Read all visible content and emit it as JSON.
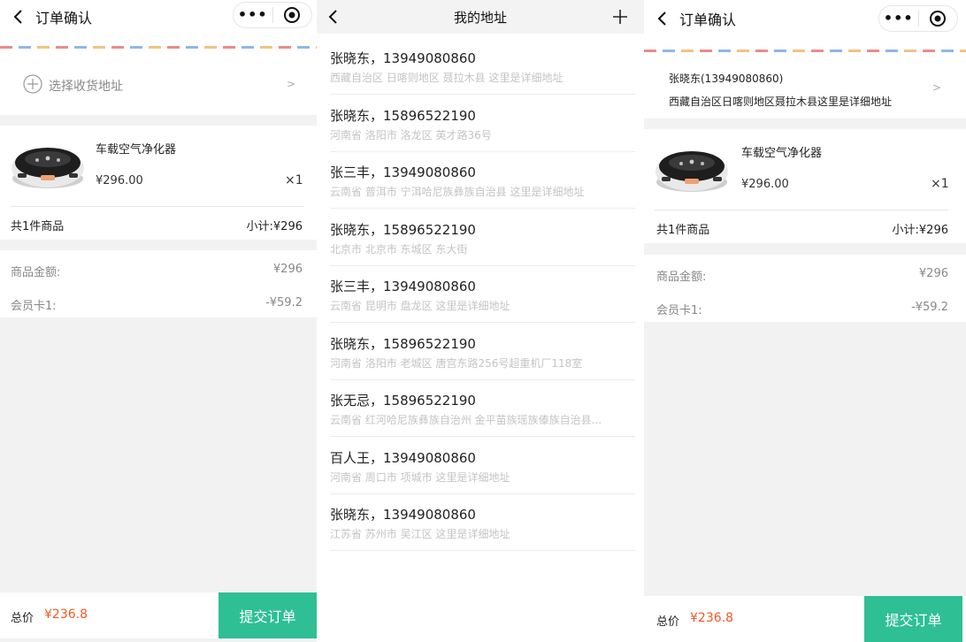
{
  "screen_order_1": {
    "title": "订单确认",
    "capsule_more": "•••",
    "select_address": "选择收货地址",
    "arrow": ">",
    "product_name": "车载空气净化器",
    "product_price": "¥296.00",
    "product_qty": "×1",
    "count_text": "共1件商品",
    "subtotal": "小计:¥296",
    "amount_label": "商品金额:",
    "amount_value": "¥296",
    "member_label": "会员卡1:",
    "member_value": "-¥59.2",
    "total_label": "总价",
    "total_value": "¥236.8",
    "submit": "提交订单"
  },
  "screen_address": {
    "title": "我的地址",
    "items": [
      {
        "name": "张晓东，13949080860",
        "detail": "西藏自治区 日喀则地区 聂拉木县 这里是详细地址"
      },
      {
        "name": "张晓东，15896522190",
        "detail": "河南省 洛阳市 洛龙区 英才路36号"
      },
      {
        "name": "张三丰，13949080860",
        "detail": "云南省 普洱市 宁洱哈尼族彝族自治县 这里是详细地址"
      },
      {
        "name": "张晓东，15896522190",
        "detail": "北京市 北京市 东城区 东大街"
      },
      {
        "name": "张三丰，13949080860",
        "detail": "云南省 昆明市 盘龙区 这里是详细地址"
      },
      {
        "name": "张晓东，15896522190",
        "detail": "河南省 洛阳市 老城区 唐宫东路256号超重机厂118室"
      },
      {
        "name": "张无忌，15896522190",
        "detail": "云南省 红河哈尼族彝族自治州 金平苗族瑶族傣族自治县..."
      },
      {
        "name": "百人王，13949080860",
        "detail": "河南省 周口市 项城市 这里是详细地址"
      },
      {
        "name": "张晓东，13949080860",
        "detail": "江苏省 苏州市 吴江区 这里是详细地址"
      }
    ]
  },
  "screen_order_2": {
    "title": "订单确认",
    "capsule_more": "•••",
    "address_name": "张晓东(13949080860)",
    "address_detail": "西藏自治区日喀则地区聂拉木县这里是详细地址",
    "arrow": ">",
    "product_name": "车载空气净化器",
    "product_price": "¥296.00",
    "product_qty": "×1",
    "count_text": "共1件商品",
    "subtotal": "小计:¥296",
    "amount_label": "商品金额:",
    "amount_value": "¥296",
    "member_label": "会员卡1:",
    "member_value": "-¥59.2",
    "total_label": "总价",
    "total_value": "¥236.8",
    "submit": "提交订单"
  },
  "colors": {
    "accent": "#2ebf94",
    "price": "#f05a23"
  }
}
